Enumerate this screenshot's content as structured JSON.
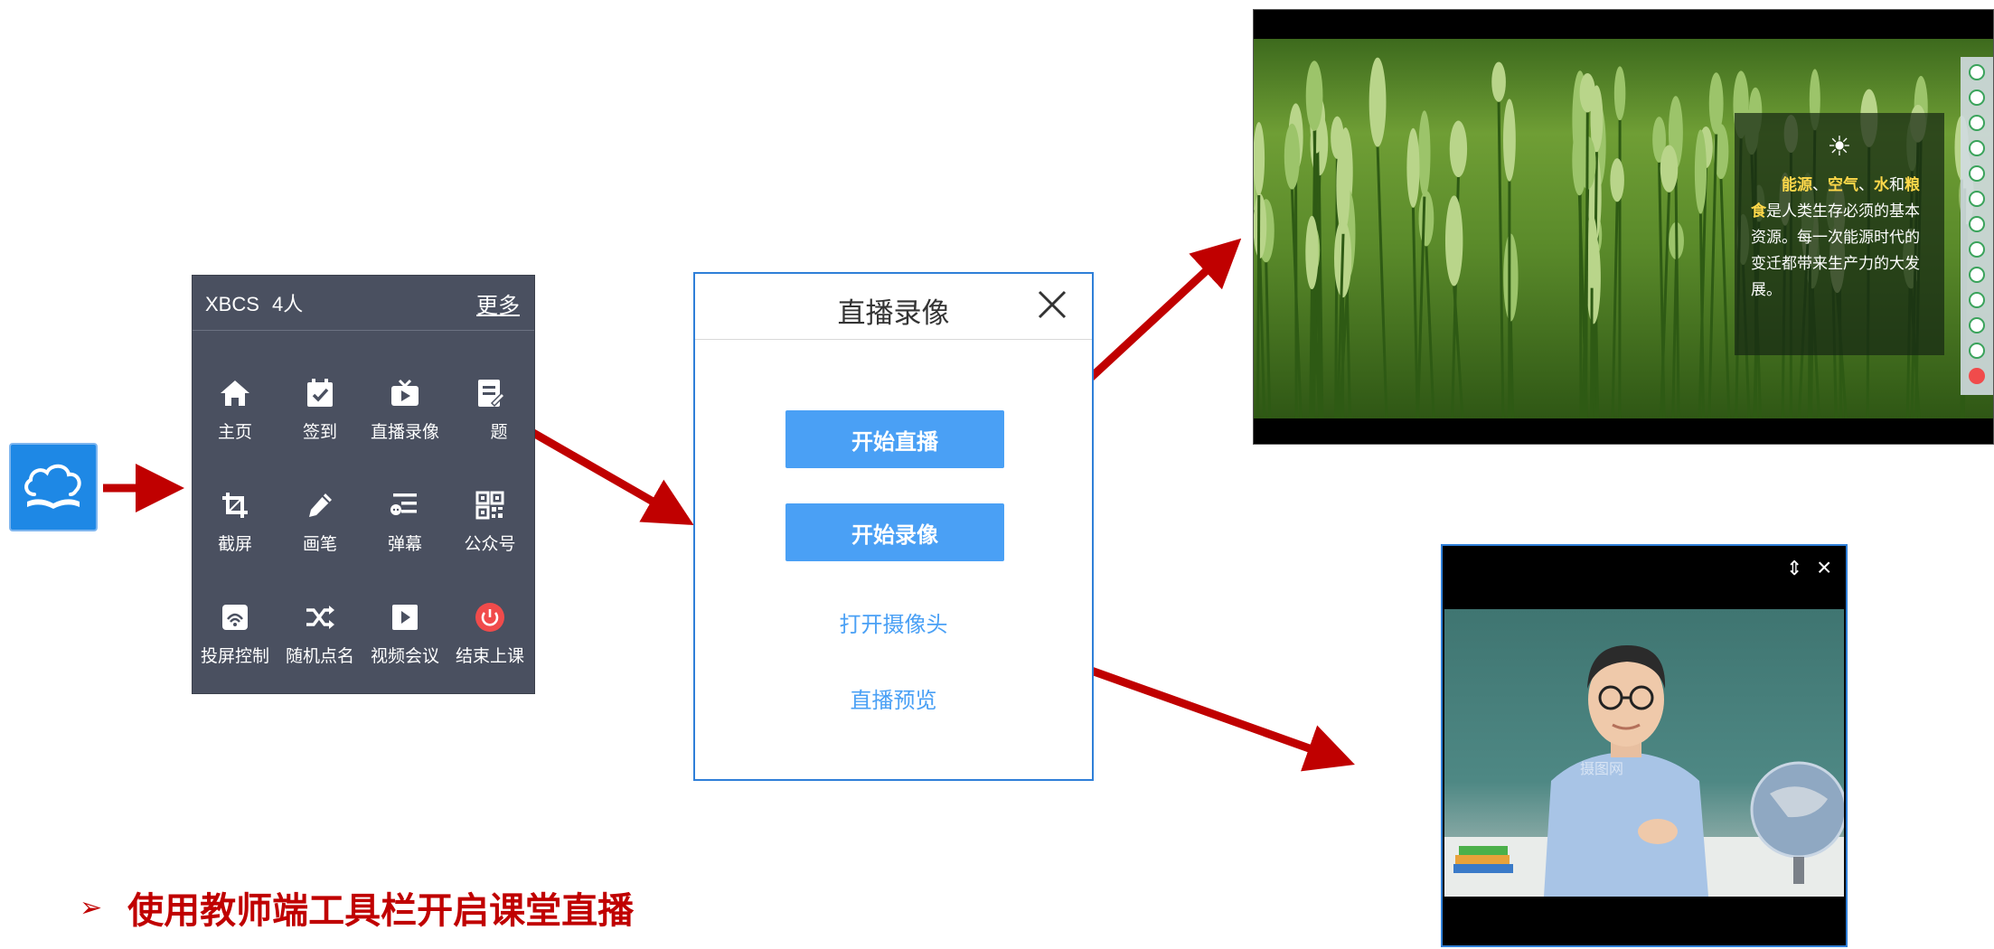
{
  "toolbar": {
    "class_name": "XBCS",
    "student_count": "4人",
    "more_label": "更多",
    "tools": [
      {
        "label": "主页",
        "icon": "home-icon"
      },
      {
        "label": "签到",
        "icon": "checkin-icon"
      },
      {
        "label": "直播录像",
        "icon": "live-tv-icon"
      },
      {
        "label": "题",
        "icon": "quiz-icon"
      },
      {
        "label": "截屏",
        "icon": "crop-icon"
      },
      {
        "label": "画笔",
        "icon": "pen-icon"
      },
      {
        "label": "弹幕",
        "icon": "danmaku-icon"
      },
      {
        "label": "公众号",
        "icon": "qrcode-icon"
      },
      {
        "label": "投屏控制",
        "icon": "cast-icon"
      },
      {
        "label": "随机点名",
        "icon": "shuffle-icon"
      },
      {
        "label": "视频会议",
        "icon": "video-icon"
      },
      {
        "label": "结束上课",
        "icon": "power-icon"
      }
    ]
  },
  "dialog": {
    "title": "直播录像",
    "start_live_label": "开始直播",
    "start_record_label": "开始录像",
    "open_camera_label": "打开摄像头",
    "live_preview_label": "直播预览"
  },
  "screen_preview": {
    "symbol": "☀",
    "text_parts": [
      {
        "text": "能源",
        "highlight": true
      },
      {
        "text": "、",
        "highlight": false
      },
      {
        "text": "空气",
        "highlight": true
      },
      {
        "text": "、",
        "highlight": false
      },
      {
        "text": "水",
        "highlight": true
      },
      {
        "text": "和",
        "highlight": false
      },
      {
        "text": "粮食",
        "highlight": true
      },
      {
        "text": "是人类生存必须的基本资源。每一次能源时代的变迁都带来生产力的大发展。",
        "highlight": false
      }
    ]
  },
  "camera_preview": {
    "pin_label": "⇕",
    "close_label": "×",
    "watermark": "摄图网"
  },
  "caption": {
    "bullet": "➢",
    "text": "使用教师端工具栏开启课堂直播"
  },
  "colors": {
    "arrow": "#c00000",
    "toolbar_bg": "#4a5060",
    "accent_blue": "#4aa0f5",
    "highlight_yellow": "#ffd84a"
  }
}
